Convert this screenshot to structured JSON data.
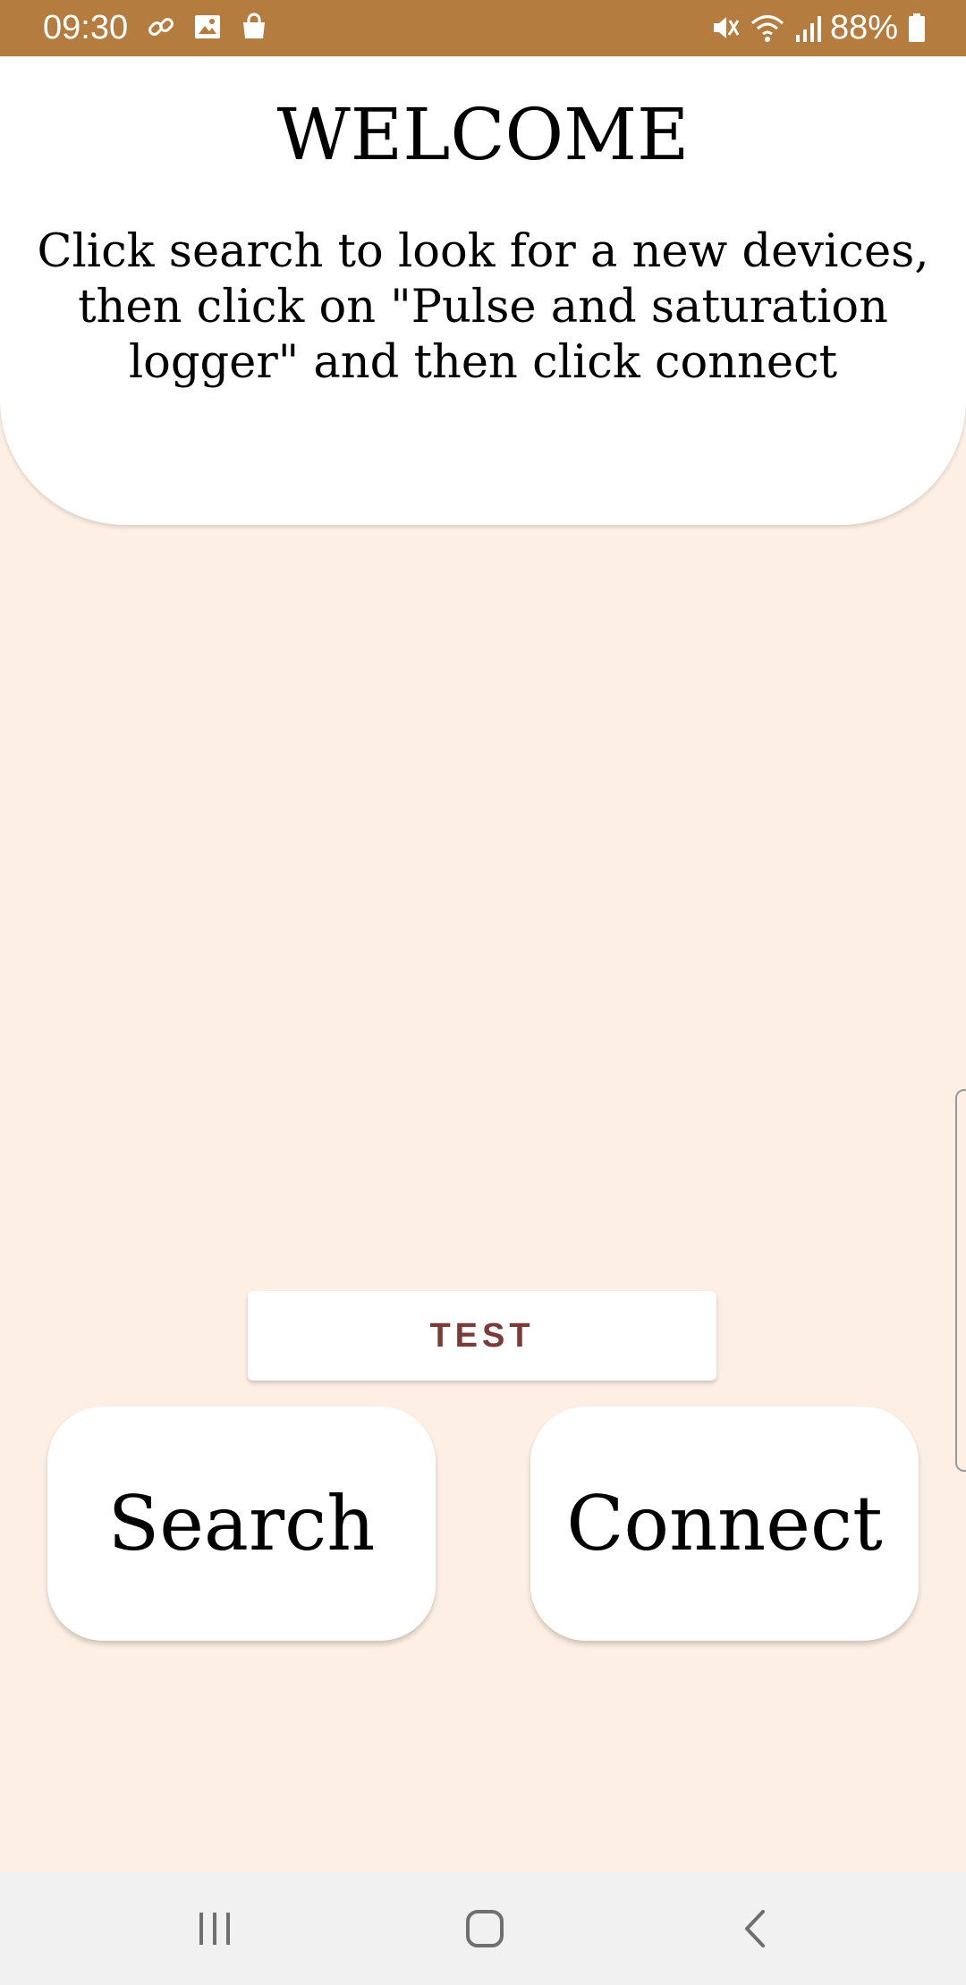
{
  "status_bar": {
    "time": "09:30",
    "battery_percent": "88%",
    "left_icons": [
      "link-icon",
      "gallery-icon",
      "shopping-bag-icon"
    ],
    "right_icons": [
      "mute-icon",
      "wifi-icon",
      "signal-icon",
      "battery-icon"
    ],
    "bar_color": "#b57c40"
  },
  "header": {
    "title": "WELCOME",
    "instructions": "Click search to look for a new devices, then click on \"Pulse and saturation logger\" and then click connect"
  },
  "actions": {
    "test_label": "TEST",
    "search_label": "Search",
    "connect_label": "Connect"
  },
  "navigation": {
    "items": [
      "recents-icon",
      "home-icon",
      "back-icon"
    ]
  },
  "colors": {
    "background": "#fdefe3",
    "card": "#ffffff",
    "test_text": "#7b3b36"
  }
}
